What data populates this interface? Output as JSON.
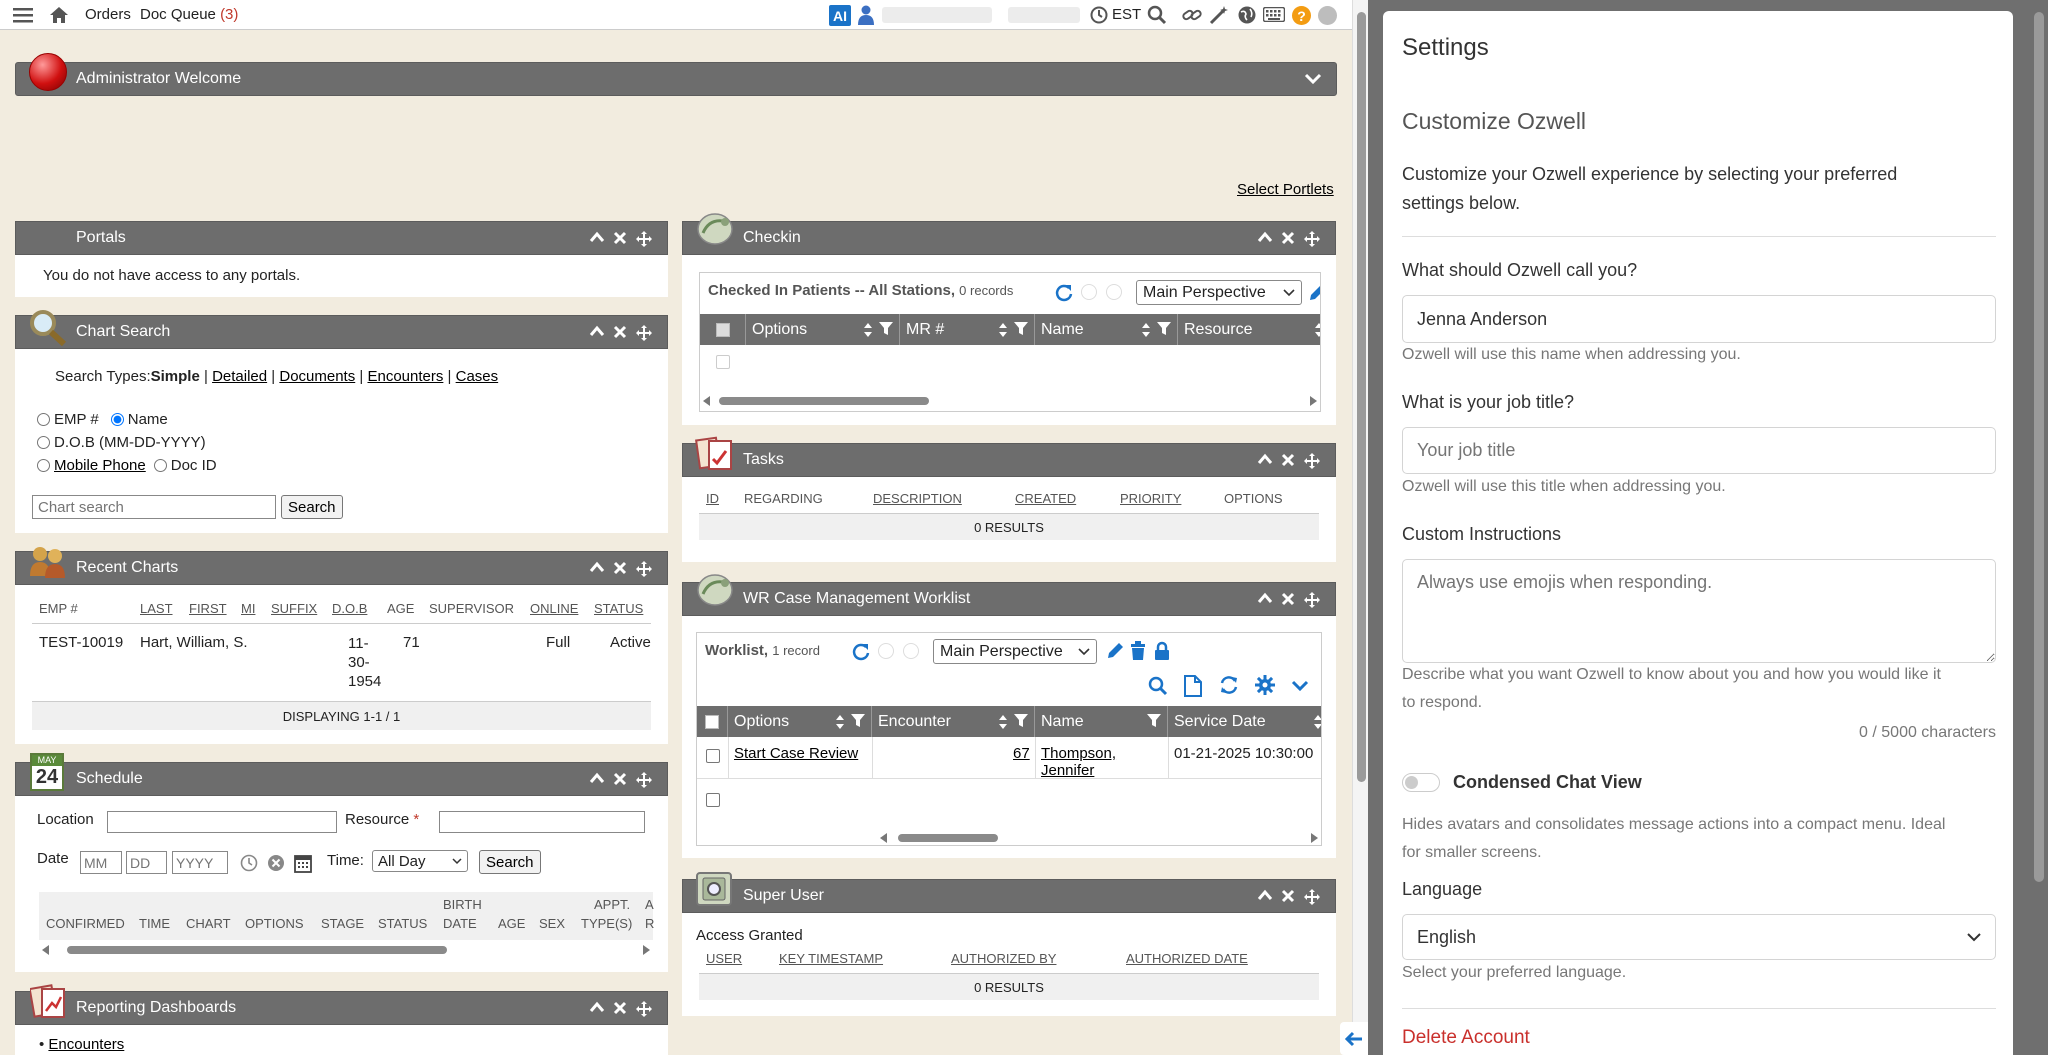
{
  "topbar": {
    "orders": "Orders",
    "doc_queue": "Doc Queue",
    "doc_queue_count": "(3)",
    "ai_badge": "AI",
    "timezone": "EST"
  },
  "admin_welcome": {
    "title": "Administrator Welcome",
    "select_portlets": "Select Portlets"
  },
  "portals": {
    "title": "Portals",
    "message": "You do not have access to any portals."
  },
  "chart_search": {
    "title": "Chart Search",
    "types_label": "Search Types:",
    "type_simple": "Simple",
    "sep": "|",
    "type_detailed": "Detailed",
    "type_documents": "Documents",
    "type_encounters": "Encounters",
    "type_cases": "Cases",
    "opt_emp": "EMP #",
    "opt_name": "Name",
    "opt_dob": "D.O.B (MM-DD-YYYY)",
    "opt_mobile": "Mobile Phone",
    "opt_docid": "Doc ID",
    "placeholder": "Chart search",
    "search_button": "Search"
  },
  "recent_charts": {
    "title": "Recent Charts",
    "headers": {
      "emp": "EMP #",
      "last": "LAST",
      "first": "FIRST",
      "mi": "MI",
      "suffix": "SUFFIX",
      "dob": "D.O.B",
      "age": "AGE",
      "supervisor": "SUPERVISOR",
      "online": "ONLINE",
      "status": "STATUS"
    },
    "row": {
      "emp": "TEST-10019",
      "name": "Hart, William, S.",
      "dob_1": "11-",
      "dob_2": "30-",
      "dob_3": "1954",
      "age": "71",
      "online": "Full",
      "status": "Active"
    },
    "footer": "DISPLAYING 1-1 / 1"
  },
  "schedule": {
    "title": "Schedule",
    "calendar_month": "MAY",
    "calendar_day": "24",
    "location_label": "Location",
    "resource_label": "Resource",
    "required_mark": "*",
    "date_label": "Date",
    "mm": "MM",
    "dd": "DD",
    "yyyy": "YYYY",
    "time_label": "Time:",
    "time_value": "All Day",
    "search_button": "Search",
    "headers": {
      "confirmed": "CONFIRMED",
      "time": "TIME",
      "chart": "CHART",
      "options": "OPTIONS",
      "stage": "STAGE",
      "status": "STATUS",
      "birth_1": "BIRTH",
      "birth_2": "DATE",
      "age": "AGE",
      "sex": "SEX",
      "appt_1": "APPT.",
      "appt_2": "TYPE(S)",
      "a_1": "A",
      "a_2": "R"
    }
  },
  "reporting": {
    "title": "Reporting Dashboards",
    "item": "Encounters"
  },
  "checkin": {
    "title": "Checkin",
    "subtitle": "Checked In Patients -- All Stations,",
    "records": "0 records",
    "perspective": "Main Perspective",
    "columns": {
      "options": "Options",
      "mr": "MR #",
      "name": "Name",
      "resource": "Resource"
    }
  },
  "tasks": {
    "title": "Tasks",
    "headers": {
      "id": "ID",
      "regarding": "REGARDING",
      "description": "DESCRIPTION",
      "created": "CREATED",
      "priority": "PRIORITY",
      "options": "OPTIONS"
    },
    "results": "0 RESULTS"
  },
  "worklist": {
    "title": "WR Case Management Worklist",
    "label": "Worklist,",
    "records": "1 record",
    "perspective": "Main Perspective",
    "columns": {
      "options": "Options",
      "encounter": "Encounter",
      "name": "Name",
      "service_date": "Service Date"
    },
    "row": {
      "options": "Start Case Review",
      "encounter": "67",
      "name_1": "Thompson,",
      "name_2": "Jennifer",
      "service_date": "01-21-2025 10:30:00"
    }
  },
  "super_user": {
    "title": "Super User",
    "access": "Access Granted",
    "headers": {
      "user": "USER",
      "key": "KEY TIMESTAMP",
      "authorized_by": "AUTHORIZED BY",
      "authorized_date": "AUTHORIZED DATE"
    },
    "results": "0 RESULTS"
  },
  "settings": {
    "title": "Settings",
    "section": "Customize Ozwell",
    "intro_1": "Customize your Ozwell experience by selecting your preferred",
    "intro_2": "settings below.",
    "name_label": "What should Ozwell call you?",
    "name_value": "Jenna Anderson",
    "name_help": "Ozwell will use this name when addressing you.",
    "job_label": "What is your job title?",
    "job_placeholder": "Your job title",
    "job_help": "Ozwell will use this title when addressing you.",
    "ci_label": "Custom Instructions",
    "ci_placeholder": "Always use emojis when responding.",
    "ci_help_1": "Describe what you want Ozwell to know about you and how you would like it",
    "ci_help_2": "to respond.",
    "char_count": "0 / 5000 characters",
    "condensed_label": "Condensed Chat View",
    "condensed_help_1": "Hides avatars and consolidates message actions into a compact menu. Ideal",
    "condensed_help_2": "for smaller screens.",
    "language_label": "Language",
    "language_value": "English",
    "language_help": "Select your preferred language.",
    "delete_account": "Delete Account"
  },
  "colors": {
    "header_gray": "#6d6d6d",
    "background": "#f2ecdf",
    "accent_blue": "#1a73c8",
    "danger": "#c9302c",
    "ai_blue": "#1a73c8",
    "help_orange": "#f39c12"
  }
}
